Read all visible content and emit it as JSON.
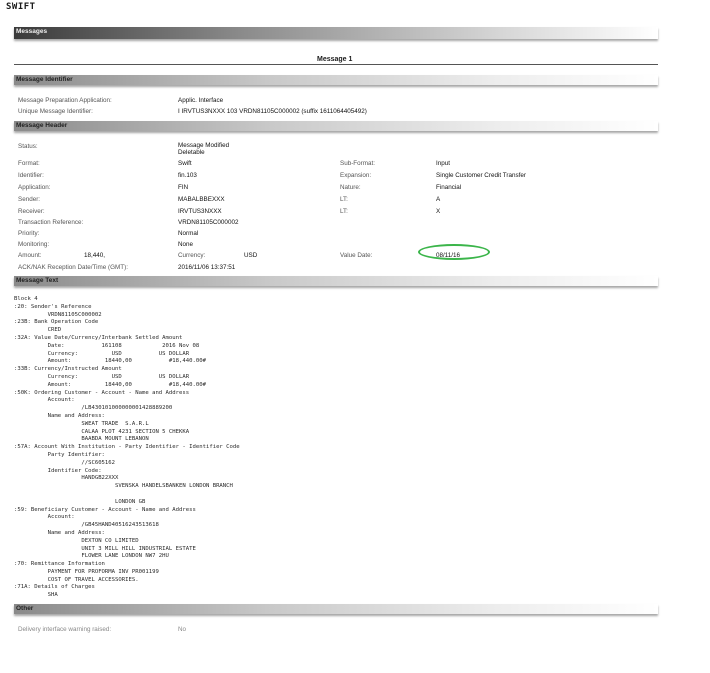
{
  "page_label": "SWIFT",
  "header_bar": "Messages",
  "message_title": "Message 1",
  "sections": {
    "identifier": "Message Identifier",
    "header": "Message Header",
    "text": "Message Text",
    "other": "Other"
  },
  "identifier": {
    "app_label": "Message Preparation Application:",
    "app_value": "Applic. Interface",
    "umi_label": "Unique Message Identifier:",
    "umi_value": "I IRVTUS3NXXX 103 VRDN81105C000002 (suffix 1611064405492)"
  },
  "header": {
    "status_label": "Status:",
    "status_value1": "Message Modified",
    "status_value2": "Deletable",
    "format_label": "Format:",
    "format_value": "Swift",
    "subformat_label": "Sub-Format:",
    "subformat_value": "Input",
    "identifier_label": "Identifier:",
    "identifier_value": "fin.103",
    "expansion_label": "Expansion:",
    "expansion_value": "Single Customer Credit Transfer",
    "application_label": "Application:",
    "application_value": "FIN",
    "nature_label": "Nature:",
    "nature_value": "Financial",
    "sender_label": "Sender:",
    "sender_value": "MABALBBEXXX",
    "lt1_label": "LT:",
    "lt1_value": "A",
    "receiver_label": "Receiver:",
    "receiver_value": "IRVTUS3NXXX",
    "lt2_label": "LT:",
    "lt2_value": "X",
    "trn_label": "Transaction Reference:",
    "trn_value": "VRDN81105C000002",
    "priority_label": "Priority:",
    "priority_value": "Normal",
    "monitoring_label": "Monitoring:",
    "monitoring_value": "None",
    "amount_label": "Amount:",
    "amount_value": "18,440,",
    "currency_label": "Currency:",
    "currency_value": "USD",
    "value_date_label": "Value Date:",
    "value_date_value": "08/11/16",
    "ack_label": "ACK/NAK Reception Date/Time (GMT):",
    "ack_value": "2016/11/06 13:37:51"
  },
  "message_text": "Block 4\n:20: Sender's Reference\n          VRDN81105C000002\n:23B: Bank Operation Code\n          CRED\n:32A: Value Date/Currency/Interbank Settled Amount\n          Date:           161108            2016 Nov 08\n          Currency:          USD           US DOLLAR\n          Amount:          18440,00           #18,440.00#\n:33B: Currency/Instructed Amount\n          Currency:          USD           US DOLLAR\n          Amount:          18440,00           #18,440.00#\n:50K: Ordering Customer - Account - Name and Address\n          Account:\n                    /LB430101000000001428889200\n          Name and Address:\n                    SWEAT TRADE  S.A.R.L\n                    CALAA PLOT 4231 SECTION 5 CHEKKA\n                    BAABDA MOUNT LEBANON\n:57A: Account With Institution - Party Identifier - Identifier Code\n          Party Identifier:\n                    //SC605162\n          Identifier Code:\n                    HANDGB22XXX\n                              SVENSKA HANDELSBANKEN LONDON BRANCH\n\n                              LONDON GB\n:59: Beneficiary Customer - Account - Name and Address\n          Account:\n                    /GB45HAND40516243513618\n          Name and Address:\n                    DEXTON CO LIMITED\n                    UNIT 3 MILL HILL INDUSTRIAL ESTATE\n                    FLOWER LANE LONDON NW7 2HU\n:70: Remittance Information\n          PAYMENT FOR PROFORMA INV PR001199\n          COST OF TRAVEL ACCESSORIES.\n:71A: Details of Charges\n          SHA",
  "other": {
    "delivery_label": "Delivery interface warning raised:",
    "delivery_value": "No"
  },
  "colors": {
    "circle": "#3bb54a"
  }
}
